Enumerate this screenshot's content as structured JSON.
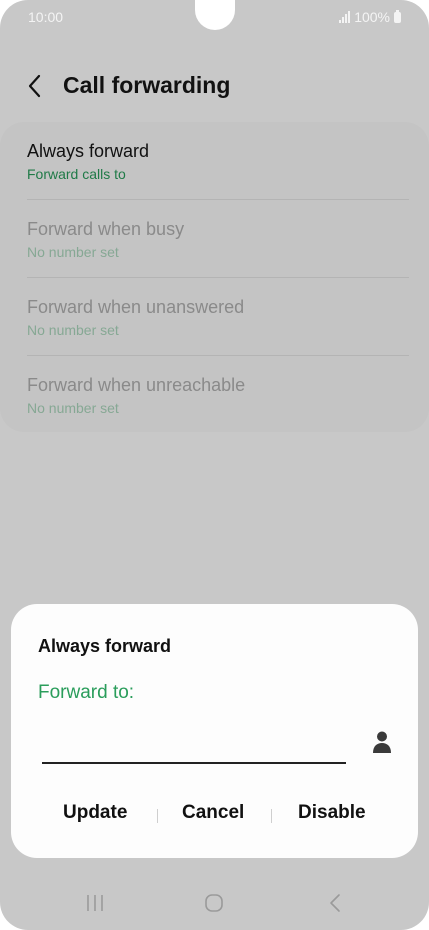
{
  "status": {
    "time": "10:00",
    "battery": "100%"
  },
  "header": {
    "title": "Call forwarding"
  },
  "options": [
    {
      "title": "Always forward",
      "subtitle": "Forward calls to"
    },
    {
      "title": "Forward when busy",
      "subtitle": "No number set"
    },
    {
      "title": "Forward when unanswered",
      "subtitle": "No number set"
    },
    {
      "title": "Forward when unreachable",
      "subtitle": "No number set"
    }
  ],
  "dialog": {
    "title": "Always forward",
    "label": "Forward to:",
    "input_value": "",
    "buttons": {
      "update": "Update",
      "cancel": "Cancel",
      "disable": "Disable"
    }
  },
  "colors": {
    "accent": "#2a9d5b",
    "overlay": "#c8c8c8"
  },
  "icons": [
    "back-arrow-icon",
    "contact-person-icon",
    "recents-icon",
    "home-icon",
    "back-nav-icon",
    "signal-icon",
    "battery-icon"
  ]
}
